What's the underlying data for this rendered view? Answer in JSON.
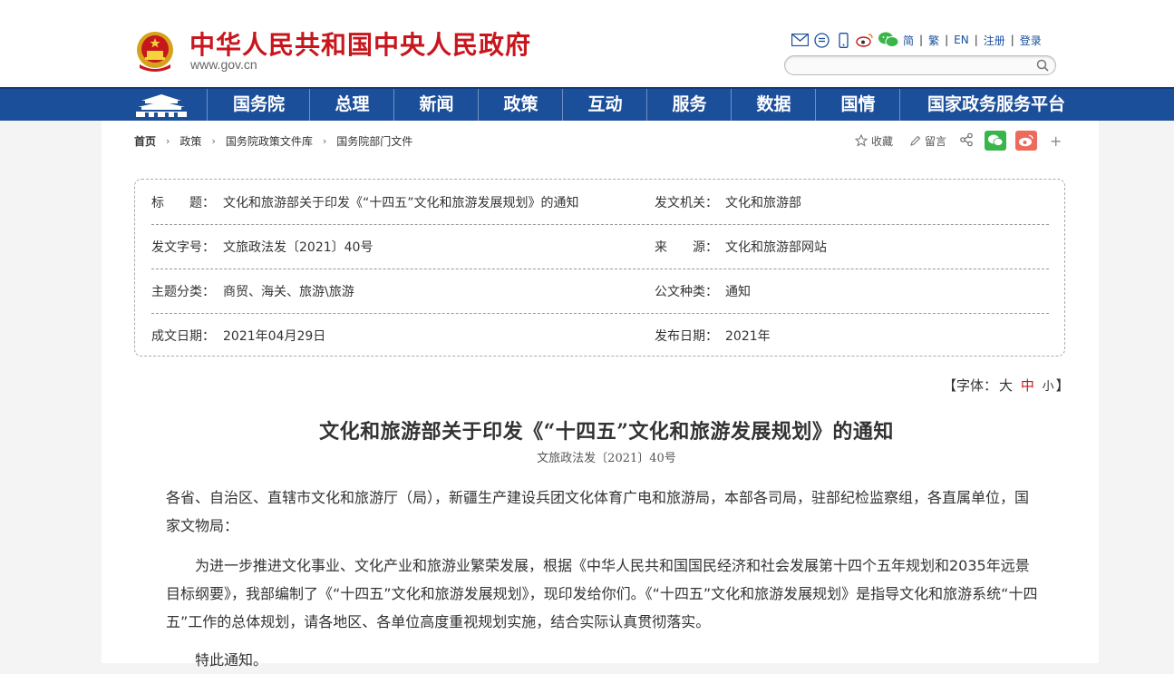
{
  "site": {
    "title": "中华人民共和国中央人民政府",
    "url": "www.gov.cn"
  },
  "header": {
    "lang_links": [
      "简",
      "繁",
      "EN",
      "注册",
      "登录"
    ],
    "icons": [
      "mail-icon",
      "message-icon",
      "mobile-icon",
      "weibo-icon",
      "wechat-icon"
    ],
    "search_placeholder": ""
  },
  "nav": {
    "items": [
      "国务院",
      "总理",
      "新闻",
      "政策",
      "互动",
      "服务",
      "数据",
      "国情",
      "国家政务服务平台"
    ]
  },
  "breadcrumb": {
    "items": [
      "首页",
      "政策",
      "国务院政策文件库",
      "国务院部门文件"
    ]
  },
  "tools": {
    "favorite": "收藏",
    "comment": "留言"
  },
  "meta": {
    "title_label": "标　　题：",
    "title_value": "文化和旅游部关于印发《“十四五”文化和旅游发展规划》的通知",
    "issuer_label": "发文机关：",
    "issuer_value": "文化和旅游部",
    "docno_label": "发文字号：",
    "docno_value": "文旅政法发〔2021〕40号",
    "source_label": "来　　源：",
    "source_value": "文化和旅游部网站",
    "topic_label": "主题分类：",
    "topic_value": "商贸、海关、旅游\\旅游",
    "type_label": "公文种类：",
    "type_value": "通知",
    "date_label": "成文日期：",
    "date_value": "2021年04月29日",
    "pub_label": "发布日期：",
    "pub_value": "2021年"
  },
  "fontsize": {
    "prefix": "【字体：",
    "large": "大",
    "medium": "中",
    "small": "小",
    "suffix": "】"
  },
  "article": {
    "title": "文化和旅游部关于印发《“十四五”文化和旅游发展规划》的通知",
    "doc_no": "文旅政法发〔2021〕40号",
    "p1": "各省、自治区、直辖市文化和旅游厅（局），新疆生产建设兵团文化体育广电和旅游局，本部各司局，驻部纪检监察组，各直属单位，国家文物局：",
    "p2": "为进一步推进文化事业、文化产业和旅游业繁荣发展，根据《中华人民共和国国民经济和社会发展第十四个五年规划和2035年远景目标纲要》，我部编制了《“十四五”文化和旅游发展规划》，现印发给你们。《“十四五”文化和旅游发展规划》是指导文化和旅游系统“十四五”工作的总体规划，请各地区、各单位高度重视规划实施，结合实际认真贯彻落实。",
    "p3": "特此通知。"
  },
  "colors": {
    "brand_red": "#c8161d",
    "nav_blue": "#1c4f9a",
    "link_blue": "#1a4f9c"
  }
}
